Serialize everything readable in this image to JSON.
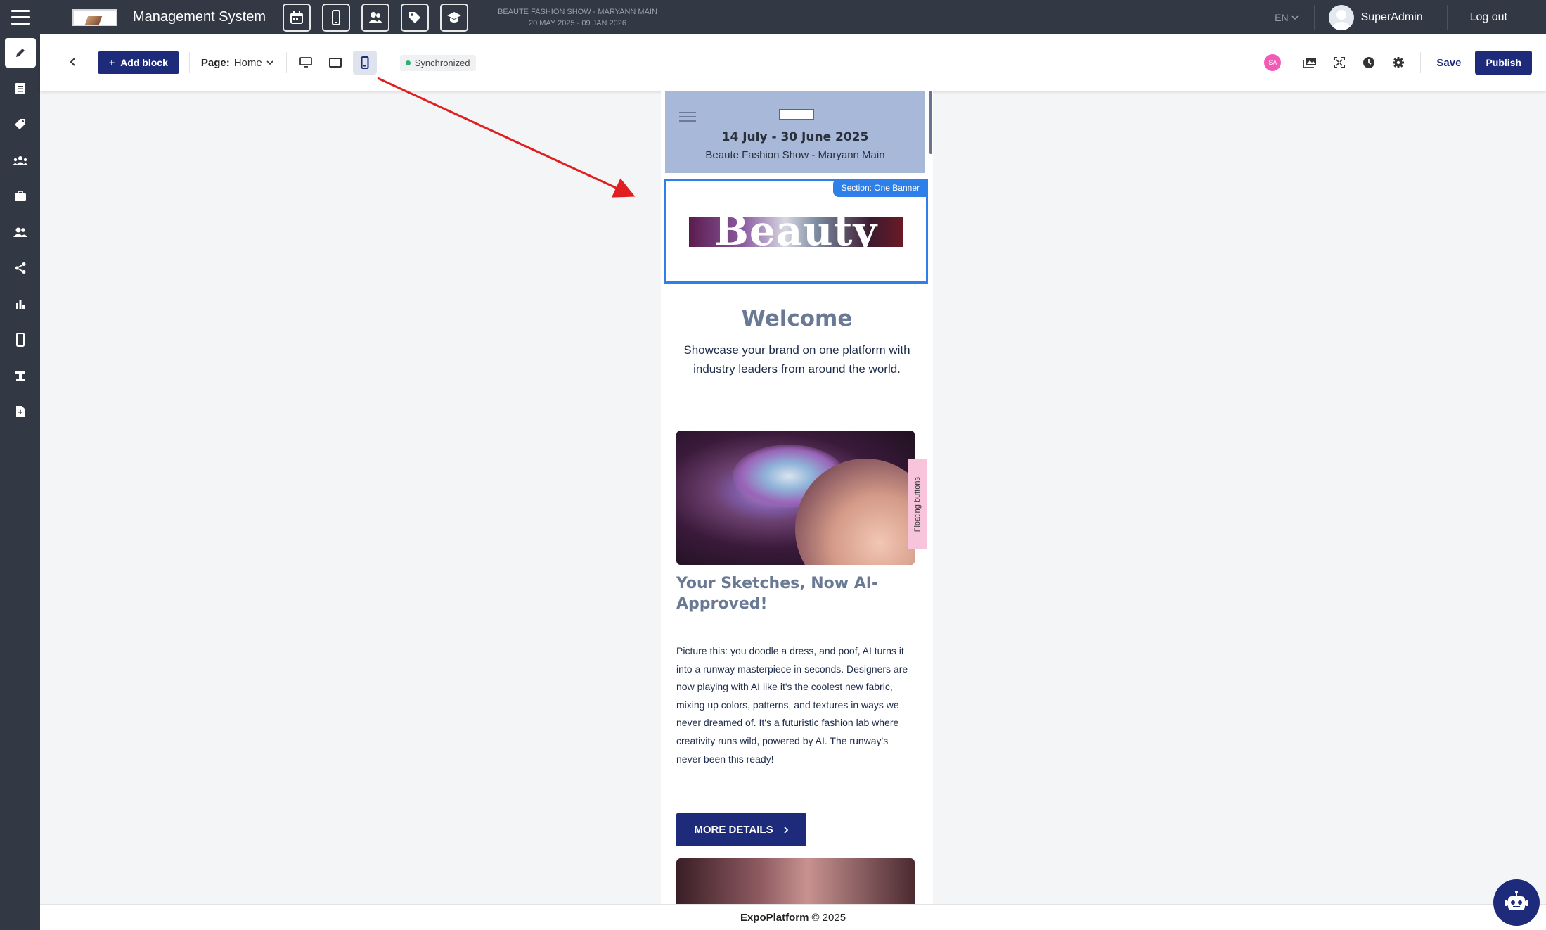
{
  "header": {
    "app_title": "Management System",
    "event_name": "BEAUTE FASHION SHOW - MARYANN MAIN",
    "event_dates": "20 MAY 2025 - 09 JAN 2026",
    "language": "EN",
    "username": "SuperAdmin",
    "logout_label": "Log out",
    "nav_icons": [
      "calendar-icon",
      "mobile-icon",
      "users-icon",
      "tag-icon",
      "graduation-cap-icon"
    ]
  },
  "sidebar": {
    "items": [
      "pencil-icon",
      "list-icon",
      "tag-icon",
      "group-icon",
      "briefcase-icon",
      "people-icon",
      "share-icon",
      "bar-chart-icon",
      "mobile-icon",
      "booth-icon",
      "document-icon"
    ]
  },
  "toolbar": {
    "add_block_label": "Add block",
    "page_label": "Page:",
    "page_value": "Home",
    "sync_status": "Synchronized",
    "user_initials": "SA",
    "save_label": "Save",
    "publish_label": "Publish"
  },
  "preview": {
    "header_dates": "14 July - 30 June 2025",
    "header_event": "Beaute Fashion Show - Maryann Main",
    "section_tag": "Section: One Banner",
    "banner_word": "Beauty",
    "welcome_title": "Welcome",
    "welcome_text": "Showcase your brand on one platform with industry leaders from around the world.",
    "floating_tab": "Floating buttons",
    "card_title": "Your Sketches, Now AI-Approved!",
    "card_text": "Picture this: you doodle a dress, and poof, AI turns it into a runway masterpiece in seconds. Designers are now playing with AI like it's the coolest new fabric, mixing up colors, patterns, and textures in ways we never dreamed of. It's a futuristic fashion lab where creativity runs wild, powered by AI. The runway's never been this ready!",
    "more_details_label": "MORE DETAILS"
  },
  "footer": {
    "brand": "ExpoPlatform",
    "copyright": "© 2025"
  },
  "colors": {
    "topbar": "#323844",
    "primary": "#1d2b7a",
    "selection": "#2f7fe8",
    "annotation_arrow": "#e02020"
  }
}
